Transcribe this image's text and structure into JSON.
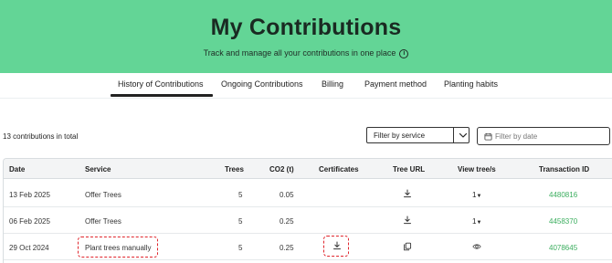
{
  "header": {
    "title": "My Contributions",
    "subtitle": "Track and manage all your contributions in one place",
    "info_icon": "info-icon",
    "background": "#63d596"
  },
  "tabs": [
    {
      "label": "History of Contributions",
      "active": true
    },
    {
      "label": "Ongoing Contributions",
      "active": false
    },
    {
      "label": "Billing",
      "active": false
    },
    {
      "label": "Payment method",
      "active": false
    },
    {
      "label": "Planting habits",
      "active": false
    }
  ],
  "summary": {
    "count_text": "13 contributions in total"
  },
  "filters": {
    "service_select": "Filter by service",
    "date_placeholder": "Filter by date"
  },
  "table": {
    "columns": [
      "Date",
      "Service",
      "Trees",
      "CO2 (t)",
      "Certificates",
      "Tree URL",
      "View tree/s",
      "Transaction ID"
    ],
    "rows": [
      {
        "date": "13 Feb 2025",
        "service": "Offer Trees",
        "trees": "5",
        "co2": "0.05",
        "tree_url_icon": "download-icon",
        "view": "1",
        "transaction_id": "4480816"
      },
      {
        "date": "06 Feb 2025",
        "service": "Offer Trees",
        "trees": "5",
        "co2": "0.25",
        "tree_url_icon": "download-icon",
        "view": "1",
        "transaction_id": "4458370"
      },
      {
        "date": "29 Oct 2024",
        "service": "Plant trees manually",
        "trees": "5",
        "co2": "0.25",
        "certificate_icon": "download-icon",
        "tree_url_icon": "copy-icon",
        "view_icon": "eye-icon",
        "transaction_id": "4078645"
      }
    ]
  },
  "colors": {
    "accent_green": "#3cae5f",
    "highlight_red": "#e0262d"
  }
}
